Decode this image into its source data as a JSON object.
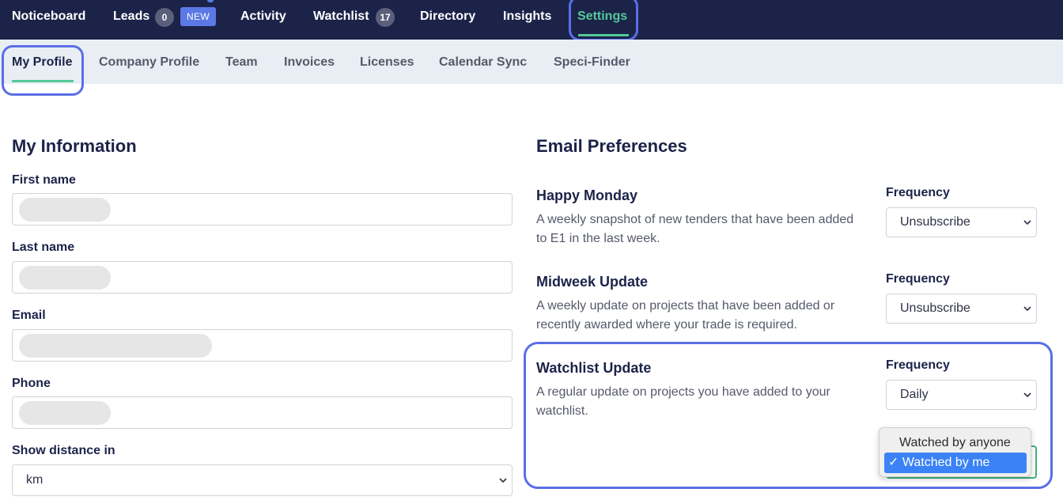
{
  "topnav": {
    "noticeboard": "Noticeboard",
    "leads": "Leads",
    "leads_count": "0",
    "new_badge": "NEW",
    "activity": "Activity",
    "watchlist": "Watchlist",
    "watchlist_count": "17",
    "directory": "Directory",
    "insights": "Insights",
    "settings": "Settings"
  },
  "subnav": {
    "my_profile": "My Profile",
    "company_profile": "Company Profile",
    "team": "Team",
    "invoices": "Invoices",
    "licenses": "Licenses",
    "calendar_sync": "Calendar Sync",
    "speci_finder": "Speci-Finder"
  },
  "my_information": {
    "title": "My Information",
    "first_name_label": "First name",
    "last_name_label": "Last name",
    "email_label": "Email",
    "phone_label": "Phone",
    "distance_label": "Show distance in",
    "distance_value": "km"
  },
  "email_preferences": {
    "title": "Email Preferences",
    "happy_monday": {
      "title": "Happy Monday",
      "desc_line1": "A weekly snapshot of new tenders that have been added",
      "desc_line2": "to E1 in the last week.",
      "frequency_label": "Frequency",
      "frequency_value": "Unsubscribe"
    },
    "midweek_update": {
      "title": "Midweek Update",
      "desc_line1": "A weekly update on projects that have been added or",
      "desc_line2": "recently awarded where your trade is required.",
      "frequency_label": "Frequency",
      "frequency_value": "Unsubscribe"
    },
    "watchlist_update": {
      "title": "Watchlist Update",
      "desc_line1": "A regular update on projects you have added to your",
      "desc_line2": "watchlist.",
      "frequency_label": "Frequency",
      "frequency_value": "Daily",
      "projects_dropdown": {
        "options": [
          "Watched by anyone",
          "Watched by me"
        ],
        "selected": "Watched by me",
        "check": "✓"
      }
    }
  },
  "colors": {
    "nav_bg": "#1c2349",
    "accent_green": "#54c99a",
    "highlight_ring": "#5a6fe6",
    "new_badge": "#5a79e6",
    "selected_option": "#3b82f6"
  }
}
